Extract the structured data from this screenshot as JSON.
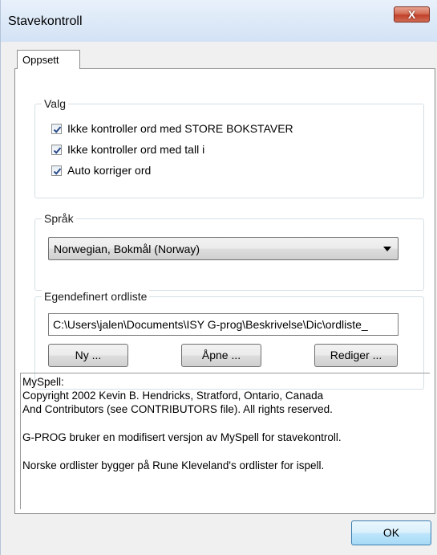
{
  "window": {
    "title": "Stavekontroll",
    "close_label": "X"
  },
  "tabs": [
    {
      "label": "Oppsett",
      "selected": true
    }
  ],
  "valg": {
    "legend": "Valg",
    "options": [
      {
        "label": "Ikke kontroller ord med STORE BOKSTAVER",
        "checked": true
      },
      {
        "label": "Ikke kontroller ord med tall i",
        "checked": true
      },
      {
        "label": "Auto korriger ord",
        "checked": true
      }
    ]
  },
  "sprak": {
    "legend": "Språk",
    "selected": "Norwegian, Bokmål (Norway)"
  },
  "ordliste": {
    "legend": "Egendefinert ordliste",
    "path_value": "C:\\Users\\jalen\\Documents\\ISY G-prog\\Beskrivelse\\Dic\\ordliste_",
    "new_label": "Ny ...",
    "open_label": "Åpne ...",
    "edit_label": "Rediger ..."
  },
  "info": {
    "lines": [
      "MySpell:",
      "Copyright 2002 Kevin B. Hendricks, Stratford, Ontario, Canada",
      "And Contributors (see CONTRIBUTORS file).  All rights reserved.",
      "G-PROG bruker en modifisert versjon av MySpell for stavekontroll.",
      "Norske ordlister bygger på Rune Kleveland's  ordlister for ispell."
    ]
  },
  "ok_label": "OK",
  "colors": {
    "title_bar": "#dbe8f7",
    "close_button": "#c7503a",
    "ok_border": "#3c7fb1"
  }
}
